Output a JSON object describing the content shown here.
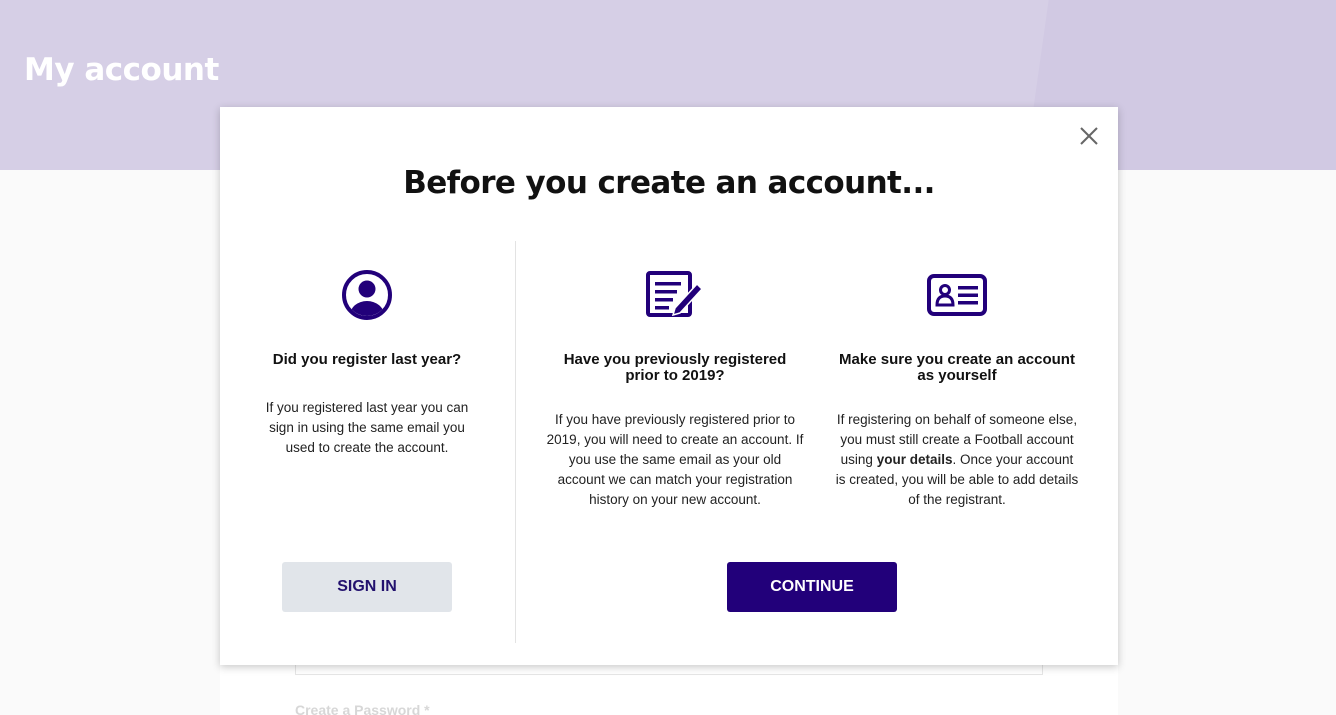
{
  "header": {
    "title": "My account"
  },
  "background": {
    "password_label": "Create a Password *"
  },
  "modal": {
    "title": "Before you create an account...",
    "columns": [
      {
        "icon": "user-circle-icon",
        "heading": "Did you register last year?",
        "text": "If you registered last year you can sign in using the same email you used to create the account."
      },
      {
        "icon": "edit-document-icon",
        "heading": "Have you previously registered prior to 2019?",
        "text": "If you have previously registered prior to 2019, you will need to create an account. If you use the same email as your old account we can match your registration history on your new account."
      },
      {
        "icon": "id-card-icon",
        "heading": "Make sure you create an account as yourself",
        "text_before": "If registering on behalf of someone else, you must still create a Football account using ",
        "text_bold": "your details",
        "text_after": ". Once your account is created, you will be able to add details of the registrant."
      }
    ],
    "sign_in_label": "SIGN IN",
    "continue_label": "CONTINUE"
  },
  "colors": {
    "brand": "#22007a",
    "header_bg": "#d6cfe6",
    "secondary_btn": "#e1e5ea"
  }
}
